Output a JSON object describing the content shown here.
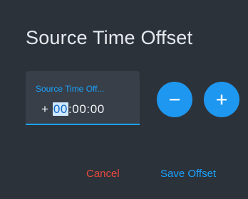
{
  "dialog": {
    "title": "Source Time Offset"
  },
  "offset_field": {
    "label": "Source Time Off...",
    "sign": "+",
    "hours": "00",
    "rest": ":00:00"
  },
  "controls": {
    "decrement_icon": "minus-icon",
    "increment_icon": "plus-icon"
  },
  "actions": {
    "cancel_label": "Cancel",
    "save_label": "Save Offset"
  },
  "colors": {
    "accent": "#1aa3ff",
    "danger": "#e8483d",
    "surface": "#2c323a",
    "field": "#383f48"
  }
}
